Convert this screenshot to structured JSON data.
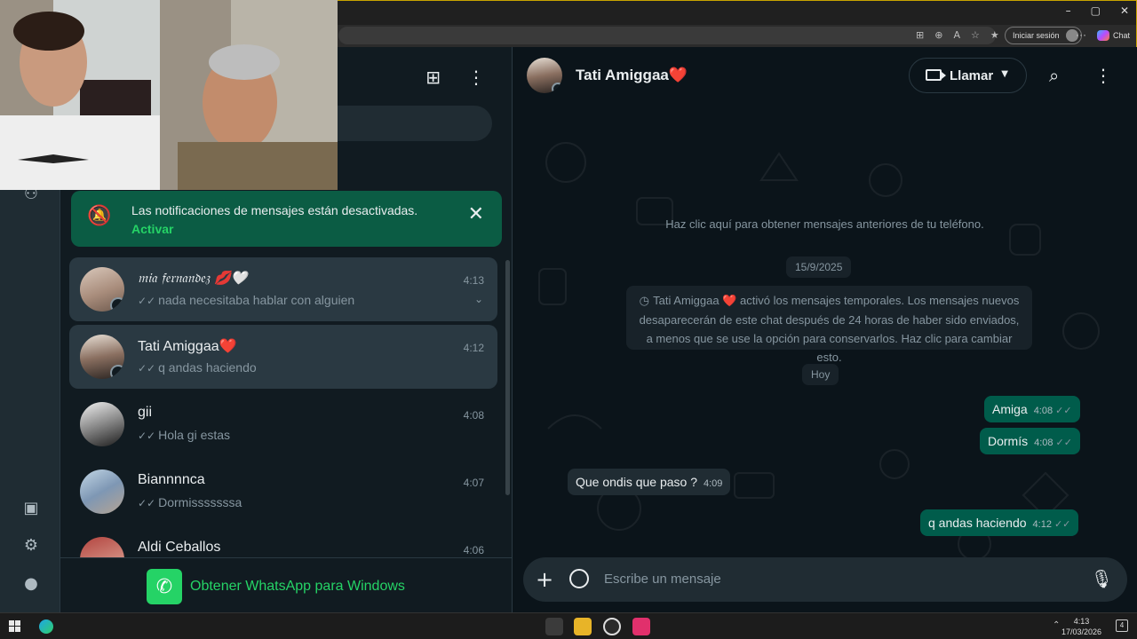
{
  "browser": {
    "window_controls": [
      "–",
      "▢",
      "✕"
    ],
    "signin_label": "Iniciar sesión",
    "copilot_label": "Chat"
  },
  "notification": {
    "text": "Las notificaciones de mensajes están desactivadas.",
    "action": "Activar"
  },
  "chats": [
    {
      "name": "𝔪𝔦𝔞 𝔣𝔢𝔯𝔫𝔞𝔫𝔡𝔢𝔷 💋🤍",
      "time": "4:13",
      "preview": "nada necesitaba hablar con alguien"
    },
    {
      "name": "Tati Amiggaa❤️",
      "time": "4:12",
      "preview": "q andas haciendo"
    },
    {
      "name": "gii",
      "time": "4:08",
      "preview": "Hola gi estas"
    },
    {
      "name": "Biannnnca",
      "time": "4:07",
      "preview": "Dormisssssssa"
    },
    {
      "name": "Aldi Ceballos",
      "time": "4:06",
      "preview": ""
    }
  ],
  "get_app": "Obtener WhatsApp para Windows",
  "conversation": {
    "title": "Tati Amiggaa❤️",
    "call_label": "Llamar",
    "older_messages": "Haz clic aquí para obtener mensajes anteriores de tu teléfono.",
    "date1": "15/9/2025",
    "temp_notice": "Tati Amiggaa ❤️ activó los mensajes temporales. Los mensajes nuevos desaparecerán de este chat después de 24 horas de haber sido enviados, a menos que se use la opción para conservarlos. Haz clic para cambiar esto.",
    "date2": "Hoy",
    "messages": [
      {
        "text": "Amiga",
        "time": "4:08",
        "dir": "out"
      },
      {
        "text": "Dormís",
        "time": "4:08",
        "dir": "out"
      },
      {
        "text": "Que ondis que paso ?",
        "time": "4:09",
        "dir": "in"
      },
      {
        "text": "q andas haciendo",
        "time": "4:12",
        "dir": "out"
      }
    ],
    "composer_placeholder": "Escribe un mensaje"
  },
  "taskbar": {
    "time": "4:13",
    "date": "17/03/2026",
    "notif_count": "4"
  },
  "colors": {
    "accent": "#25d366",
    "bubble_out": "#005c4b",
    "bubble_in": "#202c33",
    "background": "#0b141a"
  }
}
